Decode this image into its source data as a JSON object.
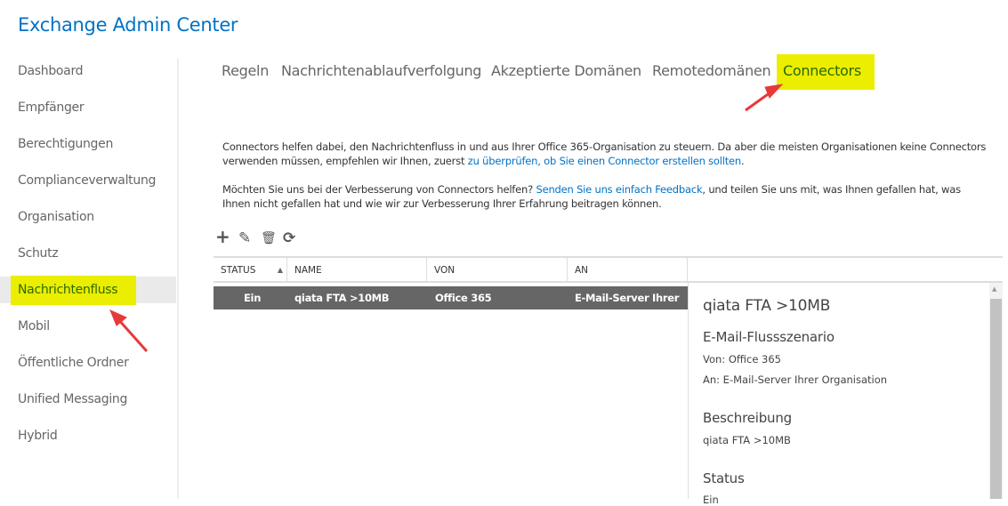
{
  "app": {
    "title": "Exchange Admin Center"
  },
  "sidebar": {
    "items": [
      {
        "label": "Dashboard"
      },
      {
        "label": "Empfänger"
      },
      {
        "label": "Berechtigungen"
      },
      {
        "label": "Complianceverwaltung"
      },
      {
        "label": "Organisation"
      },
      {
        "label": "Schutz"
      },
      {
        "label": "Nachrichtenfluss",
        "selected": true
      },
      {
        "label": "Mobil"
      },
      {
        "label": "Öffentliche Ordner"
      },
      {
        "label": "Unified Messaging"
      },
      {
        "label": "Hybrid"
      }
    ]
  },
  "tabs": [
    {
      "label": "Regeln"
    },
    {
      "label": "Nachrichtenablaufverfolgung"
    },
    {
      "label": "Akzeptierte Domänen"
    },
    {
      "label": "Remotedomänen"
    },
    {
      "label": "Connectors",
      "selected": true
    }
  ],
  "intro": {
    "p1_text": "Connectors helfen dabei, den Nachrichtenfluss in und aus Ihrer Office 365-Organisation zu steuern. Da aber die meisten Organisationen keine Connectors verwenden müssen, empfehlen wir Ihnen, zuerst ",
    "p1_link": "zu überprüfen, ob Sie einen Connector erstellen sollten",
    "p1_end": ".",
    "p2_text": "Möchten Sie uns bei der Verbesserung von Connectors helfen? ",
    "p2_link": "Senden Sie uns einfach Feedback",
    "p2_end": ", und teilen Sie uns mit, was Ihnen gefallen hat, was Ihnen nicht gefallen hat und wie wir zur Verbesserung Ihrer Erfahrung beitragen können."
  },
  "toolbar": {
    "add": "+",
    "edit": "✎",
    "delete": "🗑",
    "refresh": "⟳"
  },
  "table": {
    "headers": [
      "STATUS",
      "NAME",
      "VON",
      "AN"
    ],
    "sort_indicator": "▲",
    "rows": [
      {
        "status": "Ein",
        "name": "qiata FTA >10MB",
        "von": "Office 365",
        "an": "E-Mail-Server Ihrer ..."
      }
    ]
  },
  "detail": {
    "title": "qiata FTA >10MB",
    "scenario_heading": "E-Mail-Flussszenario",
    "von": "Von: Office 365",
    "an": "An: E-Mail-Server Ihrer Organisation",
    "desc_heading": "Beschreibung",
    "desc": "qiata FTA >10MB",
    "status_heading": "Status",
    "status": "Ein"
  },
  "colors": {
    "accent": "#0072c6",
    "highlight": "#ebee00",
    "arrow": "#e8393a",
    "selected_row": "#666666"
  }
}
